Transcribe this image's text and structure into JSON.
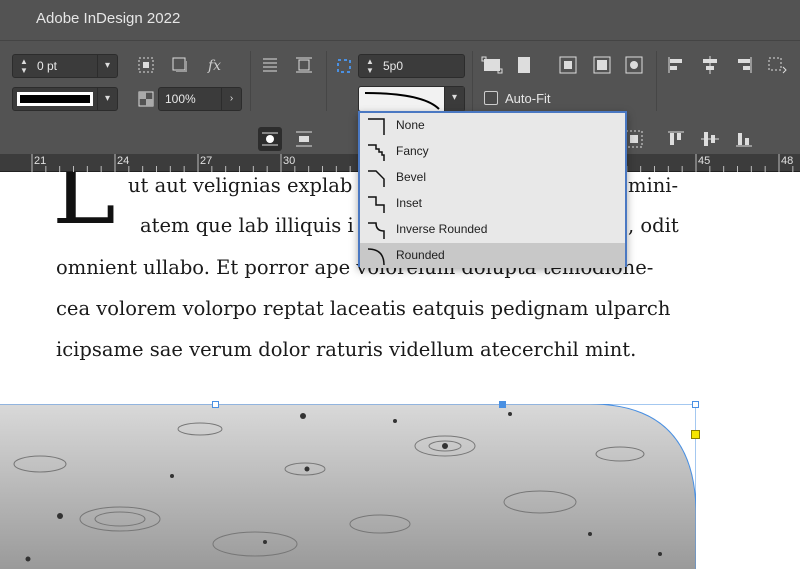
{
  "app": {
    "title": "Adobe InDesign 2022"
  },
  "controls": {
    "stroke_weight": "0 pt",
    "scale": "100%",
    "corner_size": "5p0",
    "autofit_label": "Auto-Fit"
  },
  "ruler": {
    "labels": [
      "21",
      "24",
      "27",
      "30",
      "45",
      "48"
    ]
  },
  "corner_menu": {
    "items": [
      {
        "label": "None",
        "icon": "corner-none-icon"
      },
      {
        "label": "Fancy",
        "icon": "corner-fancy-icon"
      },
      {
        "label": "Bevel",
        "icon": "corner-bevel-icon"
      },
      {
        "label": "Inset",
        "icon": "corner-inset-icon"
      },
      {
        "label": "Inverse Rounded",
        "icon": "corner-inverse-rounded-icon"
      },
      {
        "label": "Rounded",
        "icon": "corner-rounded-icon"
      }
    ],
    "selected": "Rounded"
  },
  "document": {
    "dropcap": "L",
    "lines": [
      "ut aut velignias explab",
      "mini-",
      "atem que lab illiquis i",
      ", odit",
      "omnient ullabo. Et porror ape voloreium dolupta temodione-",
      "cea volorem volorpo reptat laceatis eatquis pedignam ulparch",
      "icipsame sae verum dolor raturis videllum atecerchil mint."
    ]
  },
  "colors": {
    "panel": "#535353",
    "field": "#3b3b3b",
    "accent": "#4a90e2",
    "menu_border": "#4a78c2",
    "menu_selected": "#c8c8c8"
  }
}
